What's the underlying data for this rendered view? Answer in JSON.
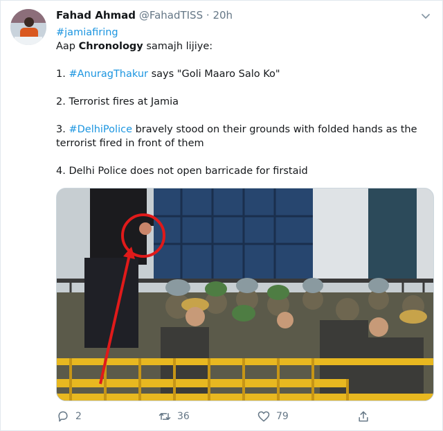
{
  "tweet": {
    "author_name": "Fahad Ahmad",
    "handle": "@FahadTISS",
    "separator": "·",
    "time": "20h",
    "hashtag_line": "#jamiafiring",
    "intro_pre": "Aap ",
    "intro_bold": "Chronology",
    "intro_post": " samajh lijiye:",
    "point1_num": "1. ",
    "point1_tag": "#AnuragThakur",
    "point1_text": " says \"Goli Maaro Salo Ko\"",
    "point2": "2. Terrorist fires at Jamia",
    "point3_num": "3. ",
    "point3_tag": "#DelhiPolice",
    "point3_text": " bravely stood on their grounds with folded hands as the terrorist fired in front of them",
    "point4": "4. Delhi Police does not open barricade for firstaid"
  },
  "actions": {
    "replies": "2",
    "retweets": "36",
    "likes": "79"
  },
  "colors": {
    "link": "#1b95e0",
    "secondary_text": "#657786",
    "annotation_red": "#e01a1a",
    "barricade_yellow": "#e8b820"
  },
  "icons": {
    "reply": "reply-icon",
    "retweet": "retweet-icon",
    "like": "heart-icon",
    "share": "share-icon",
    "more": "chevron-down-icon"
  }
}
